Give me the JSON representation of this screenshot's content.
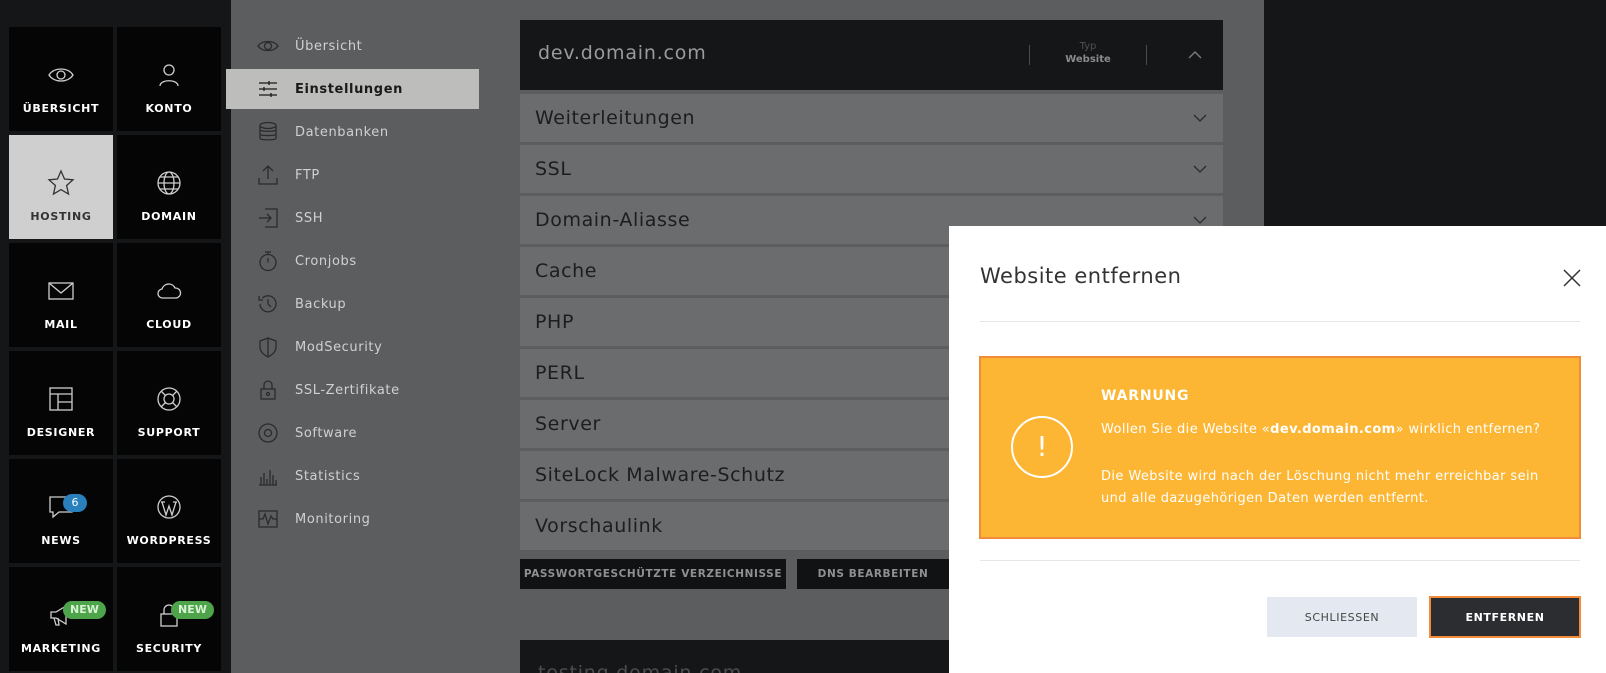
{
  "tiles": [
    {
      "label": "ÜBERSICHT",
      "icon": "eye-icon",
      "active": false
    },
    {
      "label": "KONTO",
      "icon": "user-icon",
      "active": false
    },
    {
      "label": "HOSTING",
      "icon": "star-icon",
      "active": true
    },
    {
      "label": "DOMAIN",
      "icon": "globe-icon",
      "active": false
    },
    {
      "label": "MAIL",
      "icon": "mail-icon",
      "active": false
    },
    {
      "label": "CLOUD",
      "icon": "cloud-icon",
      "active": false
    },
    {
      "label": "DESIGNER",
      "icon": "layout-icon",
      "active": false
    },
    {
      "label": "SUPPORT",
      "icon": "lifebuoy-icon",
      "active": false
    },
    {
      "label": "NEWS",
      "icon": "chat-icon",
      "active": false,
      "badge": "6"
    },
    {
      "label": "WORDPRESS",
      "icon": "wordpress-icon",
      "active": false
    },
    {
      "label": "MARKETING",
      "icon": "megaphone-icon",
      "active": false,
      "badge": "NEW"
    },
    {
      "label": "SECURITY",
      "icon": "lock-icon",
      "active": false,
      "badge": "NEW"
    }
  ],
  "subnav": [
    {
      "label": "Übersicht",
      "icon": "eye-icon"
    },
    {
      "label": "Einstellungen",
      "icon": "sliders-icon",
      "active": true
    },
    {
      "label": "Datenbanken",
      "icon": "database-icon"
    },
    {
      "label": "FTP",
      "icon": "upload-icon"
    },
    {
      "label": "SSH",
      "icon": "login-icon"
    },
    {
      "label": "Cronjobs",
      "icon": "stopwatch-icon"
    },
    {
      "label": "Backup",
      "icon": "history-icon"
    },
    {
      "label": "ModSecurity",
      "icon": "shield-icon"
    },
    {
      "label": "SSL-Zertifikate",
      "icon": "certificate-lock-icon"
    },
    {
      "label": "Software",
      "icon": "disc-icon"
    },
    {
      "label": "Statistics",
      "icon": "bar-chart-icon"
    },
    {
      "label": "Monitoring",
      "icon": "pulse-icon"
    }
  ],
  "main": {
    "domain": "dev.domain.com",
    "type_label": "Typ",
    "type_value": "Website",
    "sections": [
      "Weiterleitungen",
      "SSL",
      "Domain-Aliasse",
      "Cache",
      "PHP",
      "PERL",
      "Server",
      "SiteLock Malware-Schutz",
      "Vorschaulink"
    ],
    "btn_password_dirs": "PASSWORTGESCHÜTZTE VERZEICHNISSE",
    "btn_dns": "DNS BEARBEITEN",
    "second_domain": "testing.domain.com"
  },
  "modal": {
    "title": "Website entfernen",
    "warning_title": "WARNUNG",
    "warning_pre": "Wollen Sie die Website «",
    "warning_domain": "dev.domain.com",
    "warning_post": "» wirklich entfernen?",
    "warning_text": "Die Website wird nach der Löschung nicht mehr erreichbar sein und alle dazugehörigen Daten werden entfernt.",
    "btn_close": "SCHLIESSEN",
    "btn_remove": "ENTFERNEN"
  },
  "colors": {
    "warning_bg": "#fdb633",
    "accent_orange": "#f28b3a",
    "news_badge": "#2a7fbd",
    "new_badge": "#4ea44b"
  }
}
